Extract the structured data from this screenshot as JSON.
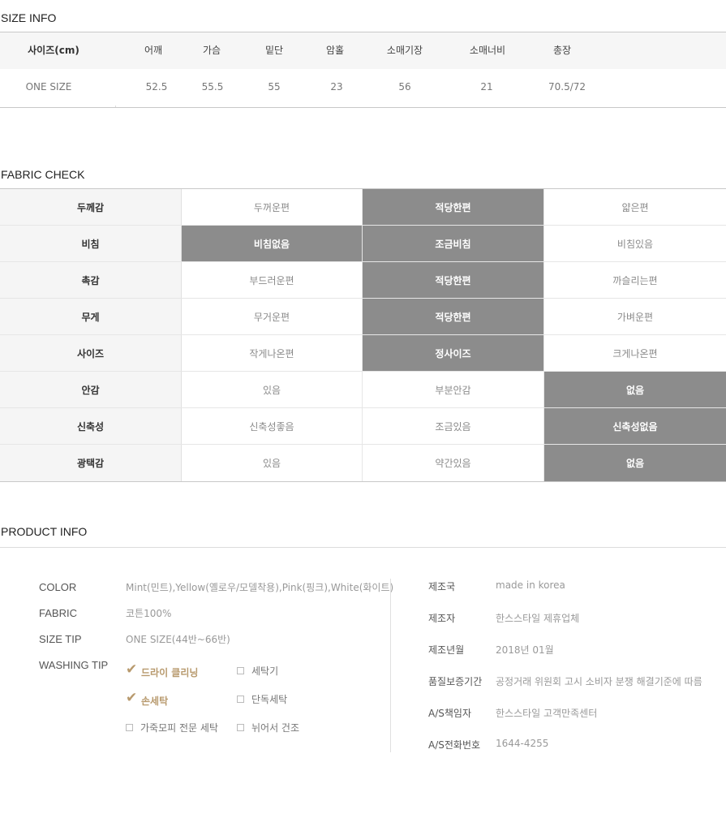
{
  "size_info": {
    "title": "SIZE INFO",
    "header_label": "사이즈(cm)",
    "columns": [
      "어깨",
      "가슴",
      "밑단",
      "암홀",
      "소매기장",
      "소매너비",
      "총장"
    ],
    "rows": [
      {
        "label": "ONE SIZE",
        "values": [
          "52.5",
          "55.5",
          "55",
          "23",
          "56",
          "21",
          "70.5/72"
        ]
      }
    ]
  },
  "fabric_check": {
    "title": "FABRIC CHECK",
    "rows": [
      {
        "label": "두께감",
        "options": [
          "두꺼운편",
          "적당한편",
          "얇은편"
        ],
        "selected": 1
      },
      {
        "label": "비침",
        "options": [
          "비침없음",
          "조금비침",
          "비침있음"
        ],
        "selected": [
          0,
          1
        ]
      },
      {
        "label": "촉감",
        "options": [
          "부드러운편",
          "적당한편",
          "까슬리는편"
        ],
        "selected": 1
      },
      {
        "label": "무게",
        "options": [
          "무거운편",
          "적당한편",
          "가벼운편"
        ],
        "selected": 1
      },
      {
        "label": "사이즈",
        "options": [
          "작게나온편",
          "정사이즈",
          "크게나온편"
        ],
        "selected": 1
      },
      {
        "label": "안감",
        "options": [
          "있음",
          "부분안감",
          "없음"
        ],
        "selected": 2
      },
      {
        "label": "신축성",
        "options": [
          "신축성좋음",
          "조금있음",
          "신축성없음"
        ],
        "selected": 2
      },
      {
        "label": "광택감",
        "options": [
          "있음",
          "약간있음",
          "없음"
        ],
        "selected": 2
      }
    ],
    "selected_color": "#8c8c8c"
  },
  "product_info": {
    "title": "PRODUCT INFO",
    "color_label": "COLOR",
    "color_value": "Mint(민트),Yellow(옐로우/모델착용),Pink(핑크),White(화이트)",
    "fabric_label": "FABRIC",
    "fabric_value": "코튼100%",
    "size_tip_label": "SIZE TIP",
    "size_tip_value": "ONE SIZE(44반~66반)",
    "washing_tip_label": "WASHING TIP",
    "washing": [
      {
        "label": "드라이 클리닝",
        "checked": true
      },
      {
        "label": "세탁기",
        "checked": false
      },
      {
        "label": "손세탁",
        "checked": true
      },
      {
        "label": "단독세탁",
        "checked": false
      },
      {
        "label": "가죽모피 전문 세탁",
        "checked": false
      },
      {
        "label": "뉘어서 건조",
        "checked": false
      }
    ],
    "check_color": "#b89a6e",
    "manufacture": [
      {
        "label": "제조국",
        "value": "made in korea"
      },
      {
        "label": "제조자",
        "value": "한스스타일 제휴업체"
      },
      {
        "label": "제조년월",
        "value": "2018년 01월"
      },
      {
        "label": "품질보증기간",
        "value": "공정거래 위원회 고시 소비자 분쟁 해결기준에 따름"
      },
      {
        "label": "A/S책임자",
        "value": "한스스타일 고객만족센터"
      },
      {
        "label": "A/S전화번호",
        "value": "1644-4255"
      }
    ]
  }
}
